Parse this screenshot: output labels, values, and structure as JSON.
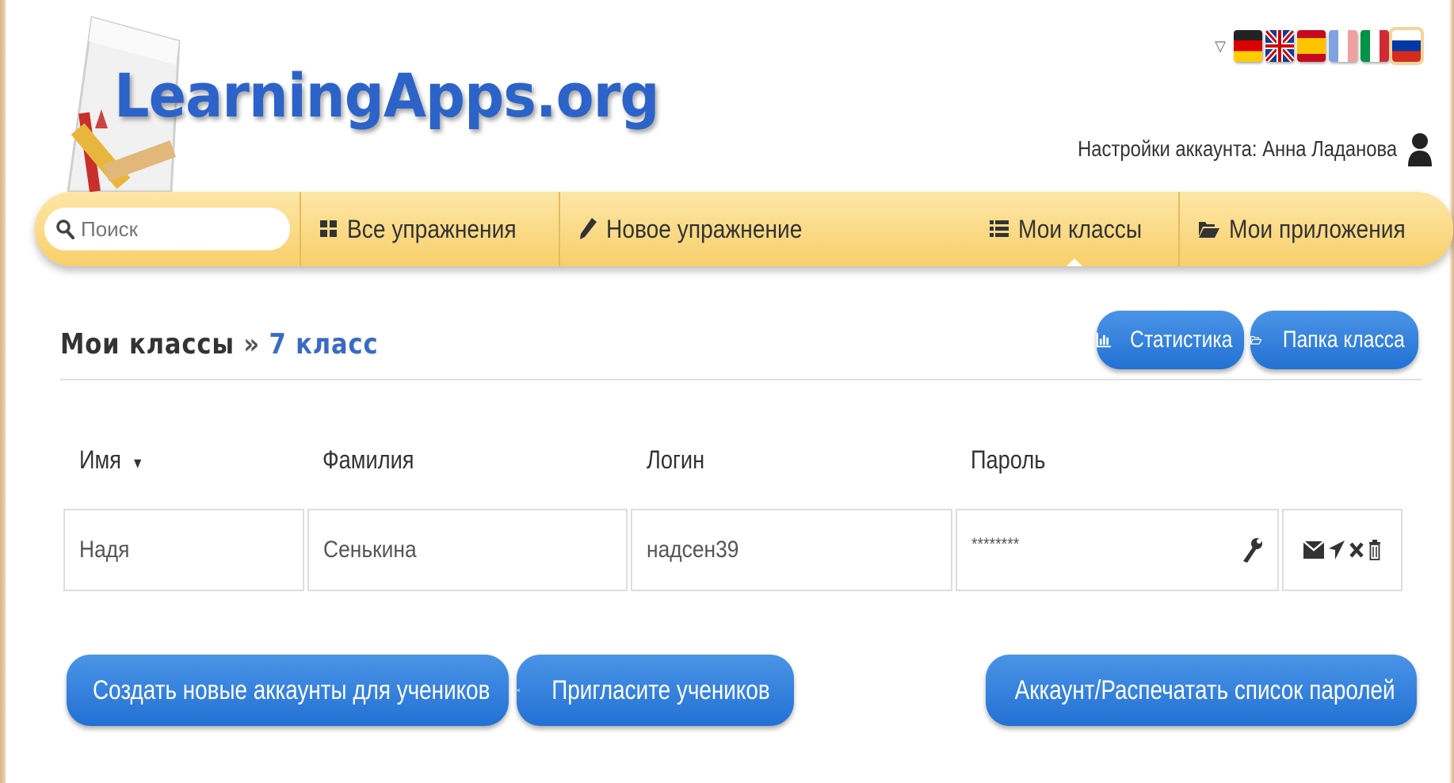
{
  "header": {
    "logo_text": "LearningApps.org",
    "languages": [
      {
        "code": "de",
        "icon": "flag-de-icon"
      },
      {
        "code": "en",
        "icon": "flag-gb-icon"
      },
      {
        "code": "es",
        "icon": "flag-es-icon"
      },
      {
        "code": "fr",
        "icon": "flag-fr-icon"
      },
      {
        "code": "it",
        "icon": "flag-it-icon"
      },
      {
        "code": "ru",
        "icon": "flag-ru-icon",
        "active": true
      }
    ],
    "account_label": "Настройки аккаунта: Анна Ладанова"
  },
  "nav": {
    "search_placeholder": "Поиск",
    "items": [
      {
        "label": "Все упражнения",
        "icon": "grid-icon"
      },
      {
        "label": "Новое упражнение",
        "icon": "pencil-icon"
      },
      {
        "label": "Мои классы",
        "icon": "list-icon",
        "active": true
      },
      {
        "label": "Мои приложения",
        "icon": "folder-open-icon"
      }
    ]
  },
  "breadcrumb": {
    "root": "Мои классы",
    "separator": "»",
    "current": "7 класс"
  },
  "buttons": {
    "statistics": "Статистика",
    "class_folder": "Папка класса",
    "create_accounts": "Создать новые аккаунты для учеников",
    "invite": "Пригласите учеников",
    "print": "Аккаунт/Распечатать список паролей"
  },
  "table": {
    "columns": [
      "Имя",
      "Фамилия",
      "Логин",
      "Пароль"
    ],
    "sort_indicator": "▾",
    "rows": [
      {
        "first_name": "Надя",
        "last_name": "Сенькина",
        "login": "надсен39",
        "password": "********"
      }
    ]
  },
  "colors": {
    "brand_blue": "#2c63c9",
    "button_blue": "#2271d4",
    "nav_yellow": "#f8cf6b",
    "link_blue": "#3a6bc4"
  }
}
